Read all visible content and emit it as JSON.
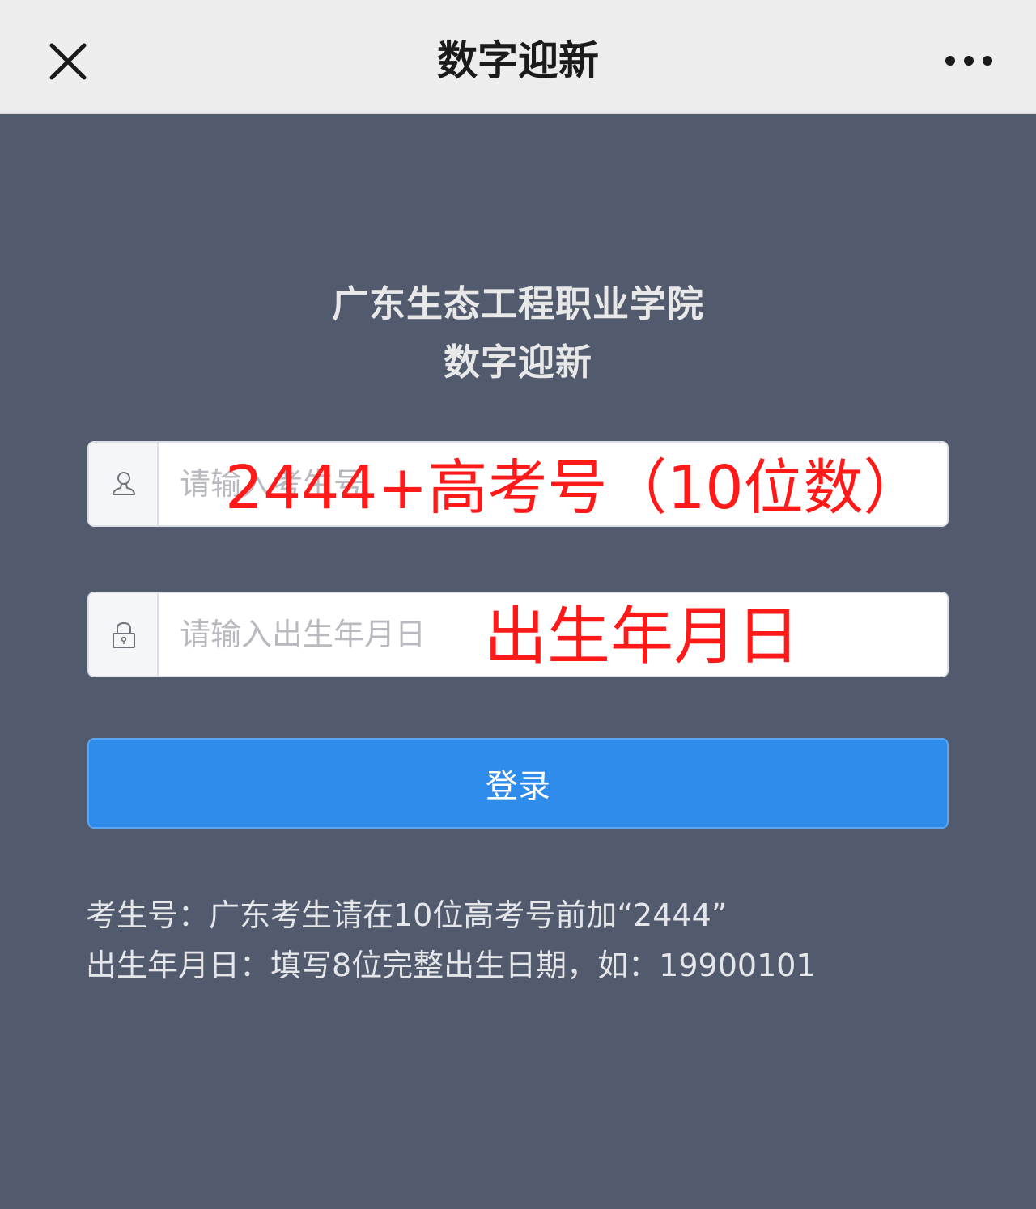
{
  "header": {
    "title": "数字迎新",
    "close_icon": "close-icon",
    "more_icon": "more-dots-icon"
  },
  "school": {
    "name": "广东生态工程职业学院",
    "subtitle": "数字迎新"
  },
  "form": {
    "username": {
      "placeholder": "请输入考生号",
      "icon": "user-icon",
      "annotation": "2444+高考号（10位数）"
    },
    "password": {
      "placeholder": "请输入出生年月日",
      "icon": "lock-icon",
      "annotation": "出生年月日"
    },
    "login_label": "登录"
  },
  "hints": {
    "line1": "考生号：广东考生请在10位高考号前加“2444”",
    "line2": "出生年月日：填写8位完整出生日期，如：19900101"
  },
  "colors": {
    "background": "#525a6d",
    "topbar": "#ededed",
    "primary_button": "#2f8cea",
    "annotation_red": "#ff1a1a"
  }
}
